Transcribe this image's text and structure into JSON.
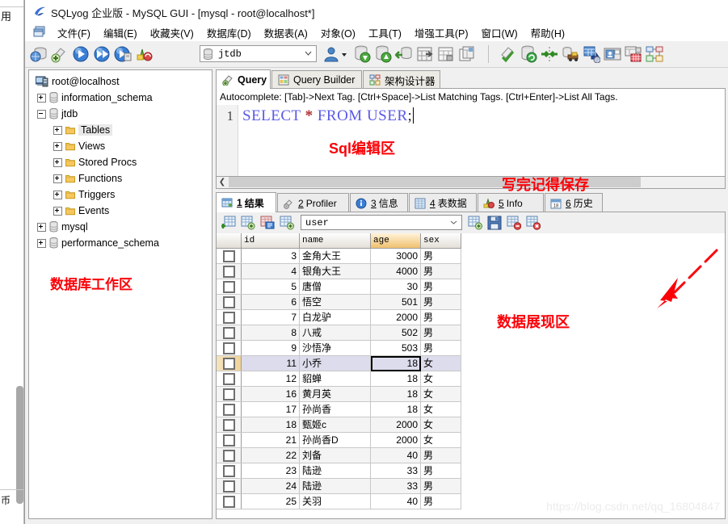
{
  "background_window": {
    "top_char": "用",
    "bottom_char": "币"
  },
  "window": {
    "title": "SQLyog 企业版 - MySQL GUI - [mysql - root@localhost*]",
    "title_icon": "sqlyog-logo-icon"
  },
  "menubar": {
    "dock_icon": "restore-window-icon",
    "items": [
      {
        "label": "文件(F)",
        "name": "menu-file"
      },
      {
        "label": "编辑(E)",
        "name": "menu-edit"
      },
      {
        "label": "收藏夹(V)",
        "name": "menu-favorites"
      },
      {
        "label": "数据库(D)",
        "name": "menu-database"
      },
      {
        "label": "数据表(A)",
        "name": "menu-table"
      },
      {
        "label": "对象(O)",
        "name": "menu-object"
      },
      {
        "label": "工具(T)",
        "name": "menu-tools"
      },
      {
        "label": "增强工具(P)",
        "name": "menu-powertools"
      },
      {
        "label": "窗口(W)",
        "name": "menu-window"
      },
      {
        "label": "帮助(H)",
        "name": "menu-help"
      }
    ]
  },
  "toolbar": {
    "db_selector": {
      "value": "jtdb",
      "icon": "database-icon",
      "arrow": "chevron-down-icon"
    },
    "icons": [
      "new-connection-icon",
      "new-query-tab-icon",
      "execute-query-icon",
      "execute-all-queries-icon",
      "execute-query-stop-icon",
      "refresh-objects-icon",
      "user-manager-icon",
      "user-dropdown-arrow-icon",
      "backup-database-icon",
      "restore-database-icon",
      "import-external-data-icon",
      "export-data-icon",
      "table-diagnostics-icon",
      "table-data-search-icon",
      "schema-sync-icon",
      "database-sync-icon",
      "data-sync-icon",
      "migrate-data-icon",
      "scheduled-backup-icon",
      "notification-services-icon",
      "query-builder-icon",
      "schema-designer-icon"
    ]
  },
  "tree": {
    "nodes": [
      {
        "label": "root@localhost",
        "icon": "server-icon",
        "indent": 0,
        "expander": "none",
        "selected": false
      },
      {
        "label": "information_schema",
        "icon": "database-icon",
        "indent": 1,
        "expander": "plus",
        "selected": false
      },
      {
        "label": "jtdb",
        "icon": "database-icon",
        "indent": 1,
        "expander": "minus",
        "selected": false
      },
      {
        "label": "Tables",
        "icon": "folder-icon",
        "indent": 2,
        "expander": "plus",
        "selected": true
      },
      {
        "label": "Views",
        "icon": "folder-icon",
        "indent": 2,
        "expander": "plus",
        "selected": false
      },
      {
        "label": "Stored Procs",
        "icon": "folder-icon",
        "indent": 2,
        "expander": "plus",
        "selected": false
      },
      {
        "label": "Functions",
        "icon": "folder-icon",
        "indent": 2,
        "expander": "plus",
        "selected": false
      },
      {
        "label": "Triggers",
        "icon": "folder-icon",
        "indent": 2,
        "expander": "plus",
        "selected": false
      },
      {
        "label": "Events",
        "icon": "folder-icon",
        "indent": 2,
        "expander": "plus",
        "selected": false
      },
      {
        "label": "mysql",
        "icon": "database-icon",
        "indent": 1,
        "expander": "plus",
        "selected": false
      },
      {
        "label": "performance_schema",
        "icon": "database-icon",
        "indent": 1,
        "expander": "plus",
        "selected": false
      }
    ]
  },
  "query_tabs": [
    {
      "label": "Query",
      "icon": "query-icon",
      "active": true
    },
    {
      "label": "Query Builder",
      "icon": "query-builder-icon",
      "active": false
    },
    {
      "label": "架构设计器",
      "icon": "schema-designer-icon",
      "active": false
    }
  ],
  "editor": {
    "hint": "Autocomplete: [Tab]->Next Tag. [Ctrl+Space]->List Matching Tags. [Ctrl+Enter]->List All Tags.",
    "line_number": "1",
    "sql_keyword1": "SELECT",
    "sql_star": "*",
    "sql_keyword2": "FROM",
    "sql_table": "USER",
    "sql_semicolon": ";",
    "scroll_left_icon": "chevron-left-icon"
  },
  "result_tabs": [
    {
      "num": "1",
      "label": "结果",
      "icon": "result-grid-icon",
      "active": true
    },
    {
      "num": "2",
      "label": "Profiler",
      "icon": "profiler-icon",
      "active": false
    },
    {
      "num": "3",
      "label": "信息",
      "icon": "info-icon",
      "active": false
    },
    {
      "num": "4",
      "label": "表数据",
      "icon": "table-data-icon",
      "active": false
    },
    {
      "num": "5",
      "label": "Info",
      "icon": "chart-info-icon",
      "active": false
    },
    {
      "num": "6",
      "label": "历史",
      "icon": "history-calendar-icon",
      "active": false
    }
  ],
  "grid_toolbar": {
    "table_selector": {
      "value": "user",
      "arrow": "chevron-down-icon"
    },
    "icons_left": [
      "insert-row-icon",
      "duplicate-row-icon",
      "copy-row-icon",
      "add-row-icon"
    ],
    "icons_right": [
      "new-record-icon",
      "save-record-icon",
      "delete-record-icon",
      "cancel-record-icon"
    ]
  },
  "grid": {
    "columns": [
      "id",
      "name",
      "age",
      "sex"
    ],
    "sorted_column": "age",
    "checkbox_column_icon": "row-checkbox-icon",
    "rows": [
      {
        "id": "3",
        "name": "金角大王",
        "age": "3000",
        "sex": "男"
      },
      {
        "id": "4",
        "name": "银角大王",
        "age": "4000",
        "sex": "男"
      },
      {
        "id": "5",
        "name": "唐僧",
        "age": "30",
        "sex": "男"
      },
      {
        "id": "6",
        "name": "悟空",
        "age": "501",
        "sex": "男"
      },
      {
        "id": "7",
        "name": "白龙驴",
        "age": "2000",
        "sex": "男"
      },
      {
        "id": "8",
        "name": "八戒",
        "age": "502",
        "sex": "男"
      },
      {
        "id": "9",
        "name": "沙悟净",
        "age": "503",
        "sex": "男"
      },
      {
        "id": "11",
        "name": "小乔",
        "age": "18",
        "sex": "女"
      },
      {
        "id": "12",
        "name": "貂蝉",
        "age": "18",
        "sex": "女"
      },
      {
        "id": "16",
        "name": "黄月英",
        "age": "18",
        "sex": "女"
      },
      {
        "id": "17",
        "name": "孙尚香",
        "age": "18",
        "sex": "女"
      },
      {
        "id": "18",
        "name": "甄姬c",
        "age": "2000",
        "sex": "女"
      },
      {
        "id": "21",
        "name": "孙尚香D",
        "age": "2000",
        "sex": "女"
      },
      {
        "id": "22",
        "name": "刘备",
        "age": "40",
        "sex": "男"
      },
      {
        "id": "23",
        "name": "陆逊",
        "age": "33",
        "sex": "男"
      },
      {
        "id": "24",
        "name": "陆逊",
        "age": "33",
        "sex": "男"
      },
      {
        "id": "25",
        "name": "关羽",
        "age": "40",
        "sex": "男"
      }
    ],
    "selected_row_index": 7,
    "focused_cell": {
      "row_index": 7,
      "column": "age"
    }
  },
  "annotations": {
    "sql_editor_label": "Sql编辑区",
    "save_reminder_label": "写完记得保存",
    "workspace_label": "数据库工作区",
    "data_area_label": "数据展现区",
    "color": "#fb0007"
  },
  "watermark": "https://blog.csdn.net/qq_16804847"
}
